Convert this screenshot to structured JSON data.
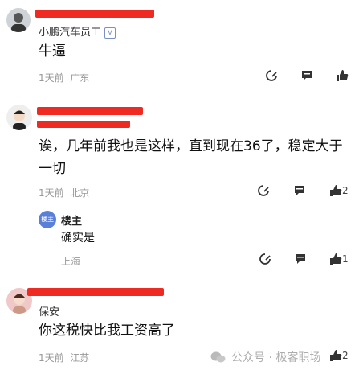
{
  "comments": [
    {
      "username": "小鹏汽车员工",
      "verified_mark": "V",
      "text": "牛逼",
      "time": "1天前",
      "location": "广东",
      "likes": ""
    },
    {
      "username": "",
      "text": "诶，几年前我也是这样，直到现在36了，稳定大于一切",
      "time": "1天前",
      "location": "北京",
      "likes": "2"
    },
    {
      "username": "保安",
      "text": "你这税快比我工资高了",
      "time": "1天前",
      "location": "江苏",
      "likes": "2"
    }
  ],
  "reply": {
    "avatar_label": "楼主",
    "name": "楼主",
    "text": "确实是",
    "location": "上海",
    "likes": "1"
  },
  "watermark": "公众号 · 极客职场",
  "icons": [
    "reply-icon",
    "comment-icon",
    "thumbs-up-icon",
    "wechat-icon"
  ]
}
